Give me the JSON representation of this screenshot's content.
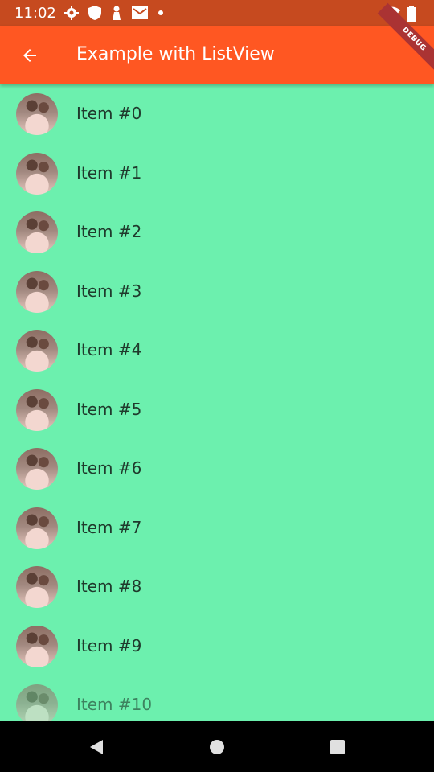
{
  "status_bar": {
    "time": "11:02",
    "icons_left": [
      "settings-icon",
      "shield-icon",
      "tower-icon",
      "mail-icon",
      "dot-icon"
    ],
    "icons_right": [
      "wifi-icon",
      "battery-icon"
    ]
  },
  "app_bar": {
    "title": "Example with ListView",
    "back_icon": "arrow-back-icon",
    "debug_banner": "DEBUG",
    "color": "#ff5722"
  },
  "list": {
    "items": [
      {
        "label": "Item #0"
      },
      {
        "label": "Item #1"
      },
      {
        "label": "Item #2"
      },
      {
        "label": "Item #3"
      },
      {
        "label": "Item #4"
      },
      {
        "label": "Item #5"
      },
      {
        "label": "Item #6"
      },
      {
        "label": "Item #7"
      },
      {
        "label": "Item #8"
      },
      {
        "label": "Item #9"
      },
      {
        "label": "Item #10"
      }
    ],
    "background": "#6cf0ae"
  },
  "nav_bar": {
    "buttons": [
      "back-triangle-icon",
      "home-circle-icon",
      "recents-square-icon"
    ]
  }
}
